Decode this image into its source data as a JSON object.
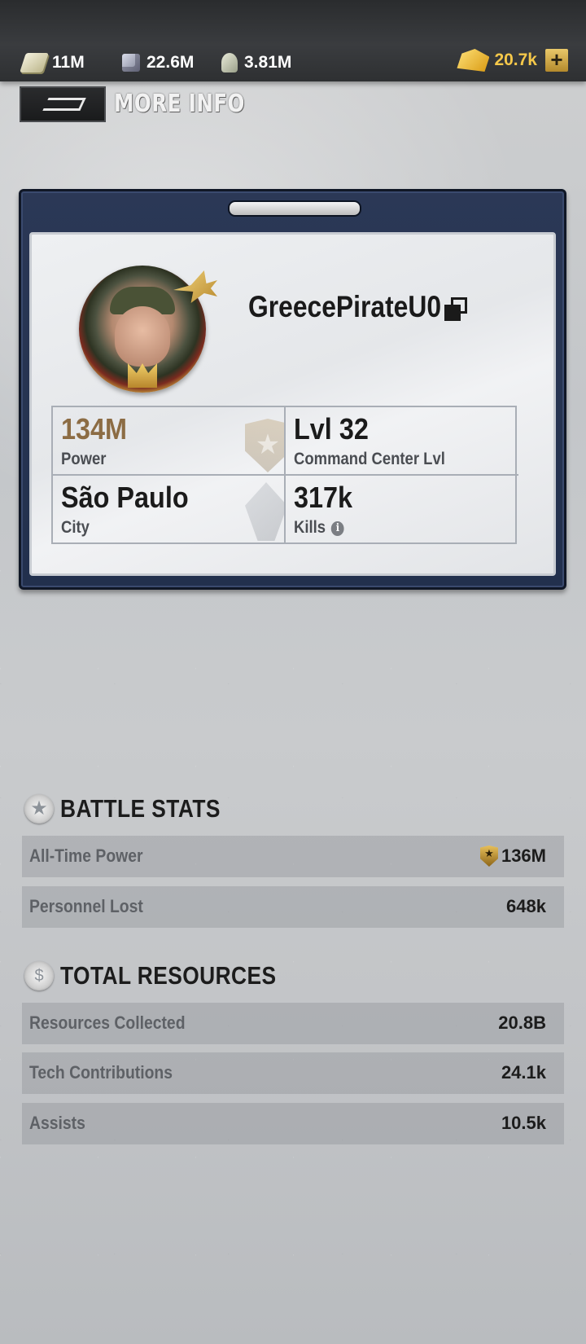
{
  "topbar": {
    "resources": [
      {
        "icon": "cash-icon",
        "value": "11M"
      },
      {
        "icon": "metal-icon",
        "value": "22.6M"
      },
      {
        "icon": "oil-icon",
        "value": "3.81M"
      }
    ],
    "gold": {
      "icon": "gold-icon",
      "value": "20.7k",
      "add_label": "+"
    }
  },
  "header": {
    "title": "MORE INFO"
  },
  "profile": {
    "name": "GreecePirateU0",
    "stats": {
      "power": {
        "value": "134M",
        "label": "Power"
      },
      "level": {
        "value": "Lvl 32",
        "label": "Command Center Lvl"
      },
      "city": {
        "value": "São Paulo",
        "label": "City"
      },
      "kills": {
        "value": "317k",
        "label": "Kills",
        "info_glyph": "i"
      }
    }
  },
  "battle_stats": {
    "title": "BATTLE STATS",
    "rows": [
      {
        "label": "All-Time Power",
        "value": "136M"
      },
      {
        "label": "Personnel Lost",
        "value": "648k"
      }
    ]
  },
  "total_resources": {
    "title": "TOTAL RESOURCES",
    "rows": [
      {
        "label": "Resources Collected",
        "value": "20.8B"
      },
      {
        "label": "Tech Contributions",
        "value": "24.1k"
      },
      {
        "label": "Assists",
        "value": "10.5k"
      }
    ]
  },
  "colors": {
    "topbar_bg": "#2e3032",
    "card_frame": "#22304d",
    "power_value": "#8c6c44",
    "gold_text": "#f5c84a"
  }
}
